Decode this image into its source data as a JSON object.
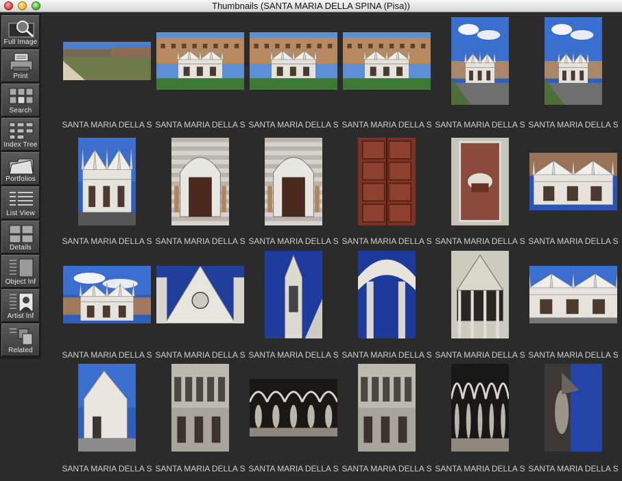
{
  "window": {
    "title": "Thumbnails (SANTA MARIA DELLA SPINA (Pisa))"
  },
  "toolbar": [
    {
      "id": "full-image",
      "label": "Full Image",
      "icon": "magnifier-icon"
    },
    {
      "id": "print",
      "label": "Print",
      "icon": "printer-icon"
    },
    {
      "id": "search",
      "label": "Search",
      "icon": "search-grid-icon"
    },
    {
      "id": "index-tree",
      "label": "Index Tree",
      "icon": "index-tree-icon"
    },
    {
      "id": "portfolios",
      "label": "Portfolios",
      "icon": "folder-icon"
    },
    {
      "id": "list-view",
      "label": "List View",
      "icon": "list-icon"
    },
    {
      "id": "details",
      "label": "Details",
      "icon": "details-icon"
    },
    {
      "id": "object-info",
      "label": "Object Inf",
      "icon": "object-info-icon"
    },
    {
      "id": "artist-info",
      "label": "Artist Inf",
      "icon": "artist-portrait-icon"
    },
    {
      "id": "related",
      "label": "Related",
      "icon": "related-icon"
    }
  ],
  "thumbnails": [
    {
      "caption": "SANTA MARIA DELLA S",
      "orientation": "landscape",
      "subject": "river-embankment"
    },
    {
      "caption": "SANTA MARIA DELLA S",
      "orientation": "landscape",
      "subject": "church-riverside"
    },
    {
      "caption": "SANTA MARIA DELLA S",
      "orientation": "landscape",
      "subject": "church-riverside"
    },
    {
      "caption": "SANTA MARIA DELLA S",
      "orientation": "landscape",
      "subject": "church-riverside"
    },
    {
      "caption": "SANTA MARIA DELLA S",
      "orientation": "portrait",
      "subject": "church-sky"
    },
    {
      "caption": "SANTA MARIA DELLA S",
      "orientation": "portrait",
      "subject": "church-sky"
    },
    {
      "caption": "SANTA MARIA DELLA S",
      "orientation": "portrait",
      "subject": "church-facade"
    },
    {
      "caption": "SANTA MARIA DELLA S",
      "orientation": "portrait",
      "subject": "church-portal"
    },
    {
      "caption": "SANTA MARIA DELLA S",
      "orientation": "portrait",
      "subject": "church-portal"
    },
    {
      "caption": "SANTA MARIA DELLA S",
      "orientation": "portrait",
      "subject": "wooden-door"
    },
    {
      "caption": "SANTA MARIA DELLA S",
      "orientation": "portrait",
      "subject": "marble-detail"
    },
    {
      "caption": "SANTA MARIA DELLA S",
      "orientation": "landscape",
      "subject": "church-spires"
    },
    {
      "caption": "SANTA MARIA DELLA S",
      "orientation": "landscape",
      "subject": "church-clouds"
    },
    {
      "caption": "SANTA MARIA DELLA S",
      "orientation": "landscape",
      "subject": "gable-rose"
    },
    {
      "caption": "SANTA MARIA DELLA S",
      "orientation": "portrait",
      "subject": "spire-closeup"
    },
    {
      "caption": "SANTA MARIA DELLA S",
      "orientation": "portrait",
      "subject": "arch-closeup"
    },
    {
      "caption": "SANTA MARIA DELLA S",
      "orientation": "portrait",
      "subject": "tabernacle"
    },
    {
      "caption": "SANTA MARIA DELLA S",
      "orientation": "landscape",
      "subject": "church-side"
    },
    {
      "caption": "SANTA MARIA DELLA S",
      "orientation": "portrait",
      "subject": "church-corner"
    },
    {
      "caption": "SANTA MARIA DELLA S",
      "orientation": "portrait",
      "subject": "facade-statues"
    },
    {
      "caption": "SANTA MARIA DELLA S",
      "orientation": "landscape",
      "subject": "statue-arcade"
    },
    {
      "caption": "SANTA MARIA DELLA S",
      "orientation": "portrait",
      "subject": "facade-statues"
    },
    {
      "caption": "SANTA MARIA DELLA S",
      "orientation": "portrait",
      "subject": "statue-arcade"
    },
    {
      "caption": "SANTA MARIA DELLA S",
      "orientation": "portrait",
      "subject": "statue-sky"
    }
  ]
}
